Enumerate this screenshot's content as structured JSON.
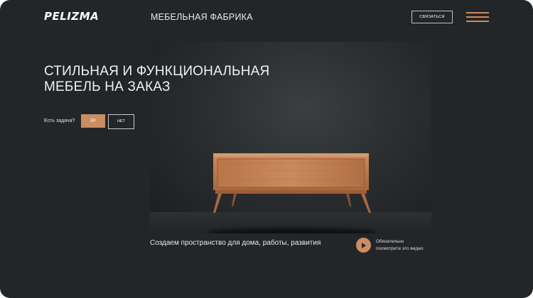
{
  "header": {
    "logo_text": "PELIZMA",
    "subtitle": "МЕБЕЛЬНАЯ ФАБРИКА",
    "contact_button": "СВЯЗАТЬСЯ",
    "menu_icon": "hamburger-menu-icon"
  },
  "hero": {
    "headline_line1": "СТИЛЬНАЯ И ФУНКЦИОНАЛЬНАЯ",
    "headline_line2": "МЕБЕЛЬ НА ЗАКАЗ",
    "question": "Есть задача?",
    "yes_button": "ДА",
    "no_button": "НЕТ"
  },
  "media": {
    "caption": "Создаем пространство для дома, работы, развития",
    "video_note_line1": "Обязательно",
    "video_note_line2": "посмотрите это видео",
    "play_icon": "play-icon"
  },
  "colors": {
    "background": "#232628",
    "accent": "#cb8d61",
    "text": "#f1f1f1"
  }
}
